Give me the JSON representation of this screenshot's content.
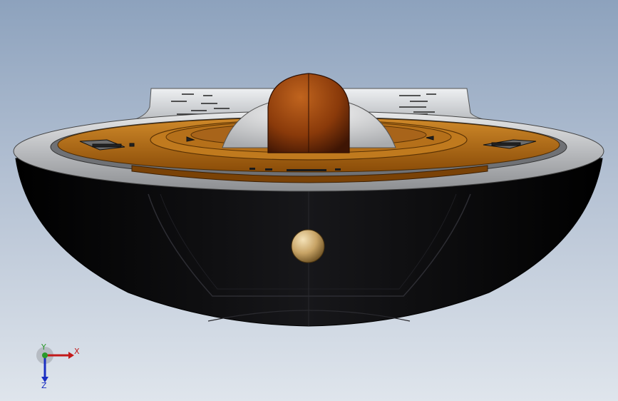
{
  "viewport": {
    "background_top": "#8da2bd",
    "background_bottom": "#dfe5ec"
  },
  "model": {
    "body_color": "#0c0c0e",
    "rim_color": "#c9cbce",
    "deck_color": "#b06a12",
    "dome_color": "#8a3a0a",
    "knob_color": "#c8a466"
  },
  "triad": {
    "x_label": "X",
    "y_label": "Y",
    "z_label": "Z",
    "x_color": "#c21a1a",
    "y_color": "#2a9a2a",
    "z_color": "#1a2ec2"
  }
}
